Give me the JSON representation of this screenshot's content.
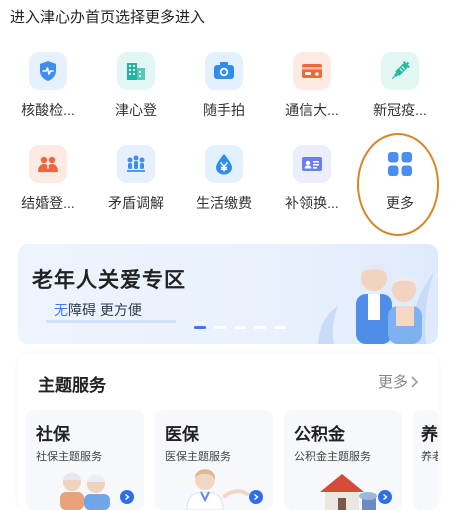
{
  "instruction": "进入津心办首页选择更多进入",
  "grid": {
    "row1": [
      {
        "label": "核酸检...",
        "icon": "nucleic-test-icon",
        "bg": "#e6f1fd",
        "color": "#3d8ef0"
      },
      {
        "label": "津心登",
        "icon": "building-icon",
        "bg": "#e2f6f3",
        "color": "#21b3a4"
      },
      {
        "label": "随手拍",
        "icon": "camera-icon",
        "bg": "#e3f0fe",
        "color": "#2f8cf0"
      },
      {
        "label": "通信大...",
        "icon": "card-icon",
        "bg": "#fdebe3",
        "color": "#f1673c"
      },
      {
        "label": "新冠疫...",
        "icon": "syringe-icon",
        "bg": "#e2f6f3",
        "color": "#20b8a2"
      }
    ],
    "row2": [
      {
        "label": "结婚登...",
        "icon": "couple-icon",
        "bg": "#fdebe3",
        "color": "#f1673c"
      },
      {
        "label": "矛盾调解",
        "icon": "mediation-icon",
        "bg": "#e6f1fd",
        "color": "#3d8ef0"
      },
      {
        "label": "生活缴费",
        "icon": "yuan-drop-icon",
        "bg": "#e3f0fe",
        "color": "#2f8cf0"
      },
      {
        "label": "补领换...",
        "icon": "id-card-icon",
        "bg": "#eceefd",
        "color": "#6a7ef2"
      },
      {
        "label": "更多",
        "icon": "more-grid-icon",
        "bg": "#ffffff",
        "color": "#4b8ef2"
      }
    ]
  },
  "banner": {
    "title": "老年人关爱专区",
    "sub_accent": "无",
    "sub_rest": "障碍 更方便"
  },
  "themes": {
    "title": "主题服务",
    "more": "更多",
    "cards": [
      {
        "title": "社保",
        "sub": "社保主题服务"
      },
      {
        "title": "医保",
        "sub": "医保主题服务"
      },
      {
        "title": "公积金",
        "sub": "公积金主题服务"
      },
      {
        "title": "养",
        "sub": "养老"
      }
    ]
  },
  "colors": {
    "accent": "#3a7bf0",
    "highlight": "#d68627"
  }
}
